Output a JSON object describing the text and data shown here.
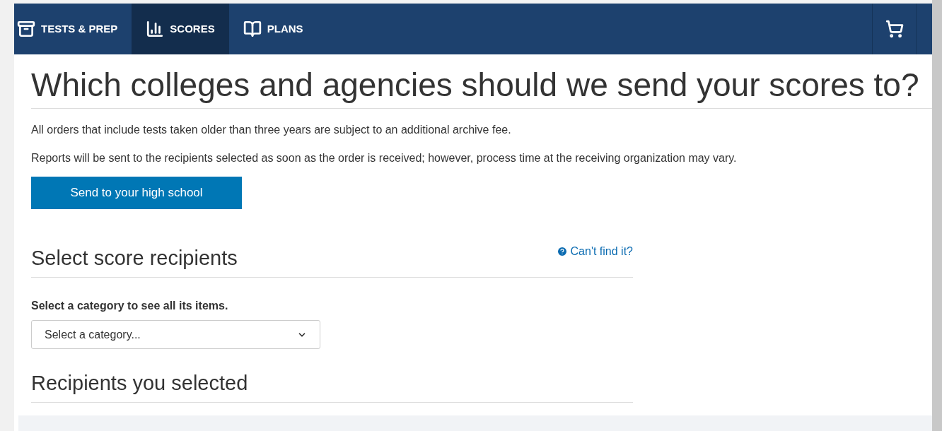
{
  "nav": {
    "tabs": [
      {
        "label": "TESTS & PREP",
        "selected": false
      },
      {
        "label": "SCORES",
        "selected": true
      },
      {
        "label": "PLANS",
        "selected": false
      }
    ]
  },
  "title": "Which colleges and agencies should we send your scores to?",
  "notes": [
    "All orders that include tests taken older than three years are subject to an additional archive fee.",
    "Reports will be sent to the recipients selected as soon as the order is received; however, process time at the receiving organization may vary."
  ],
  "high_school_button": "Send to your high school",
  "select_section": {
    "heading": "Select score recipients",
    "help_link": "Can't find it?",
    "label": "Select a category to see all its items.",
    "dropdown": {
      "value": "Select a category..."
    }
  },
  "selected_section": {
    "heading": "Recipients you selected"
  }
}
